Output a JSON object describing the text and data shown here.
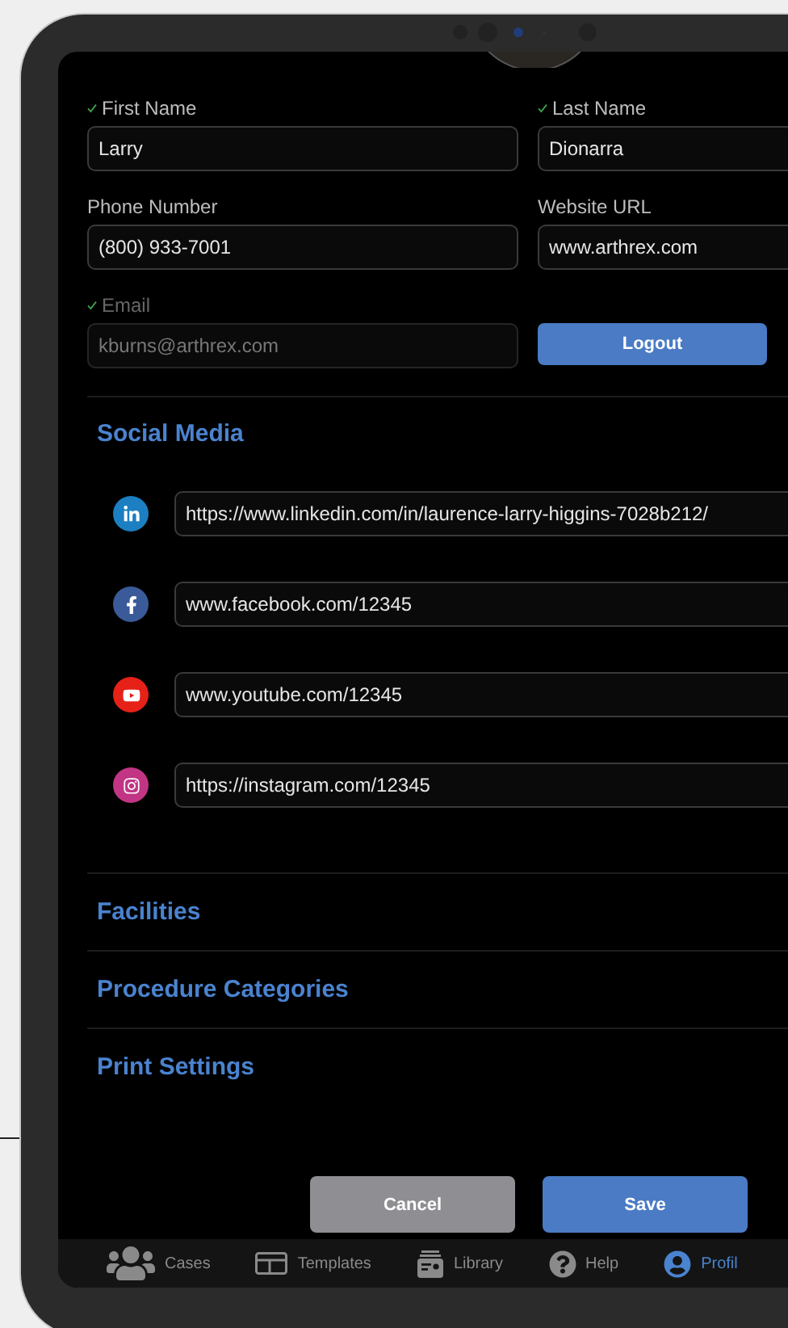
{
  "profile_form": {
    "fields": [
      {
        "label": "First Name",
        "value": "Larry",
        "valid": true,
        "disabled": false
      },
      {
        "label": "Last Name",
        "value": "Dionarra",
        "valid": true,
        "disabled": false
      },
      {
        "label": "Phone Number",
        "value": "(800) 933-7001",
        "valid": false,
        "disabled": false
      },
      {
        "label": "Website URL",
        "value": "www.arthrex.com",
        "valid": false,
        "disabled": false
      },
      {
        "label": "Email",
        "value": "kburns@arthrex.com",
        "valid": true,
        "disabled": true
      }
    ],
    "logout_button": "Logout"
  },
  "social_media": {
    "title": "Social Media",
    "links": [
      {
        "kind": "linkedin",
        "color": "#1b7fc1",
        "value": "https://www.linkedin.com/in/laurence-larry-higgins-7028b212/"
      },
      {
        "kind": "facebook",
        "color": "#3b5a9a",
        "value": "www.facebook.com/12345"
      },
      {
        "kind": "youtube",
        "color": "#e62117",
        "value": "www.youtube.com/12345"
      },
      {
        "kind": "instagram",
        "color": "#c13584",
        "value": "https://instagram.com/12345"
      }
    ]
  },
  "sections": [
    "Facilities",
    "Procedure Categories",
    "Print Settings"
  ],
  "buttons": {
    "cancel": "Cancel",
    "save": "Save"
  },
  "tab_bar": [
    {
      "kind": "cases",
      "label": "Cases",
      "selected": false
    },
    {
      "kind": "templates",
      "label": "Templates",
      "selected": false
    },
    {
      "kind": "library",
      "label": "Library",
      "selected": false
    },
    {
      "kind": "help",
      "label": "Help",
      "selected": false
    },
    {
      "kind": "profile",
      "label": "Profil",
      "selected": true
    }
  ]
}
